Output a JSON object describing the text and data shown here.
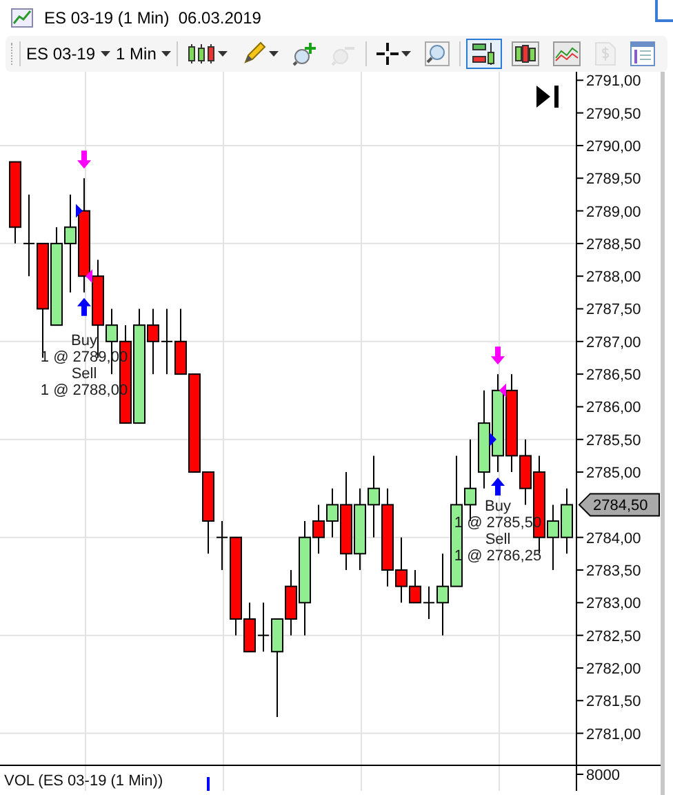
{
  "window": {
    "title": "ES 03-19 (1 Min)  06.03.2019"
  },
  "toolbar": {
    "instrument": "ES 03-19",
    "interval": "1 Min",
    "tools": [
      {
        "kind": "candles",
        "dropdown": true,
        "selected": false,
        "disabled": false
      },
      {
        "kind": "pencil",
        "dropdown": true,
        "selected": false,
        "disabled": false
      },
      {
        "kind": "zoom-in",
        "dropdown": false,
        "selected": false,
        "disabled": false
      },
      {
        "kind": "zoom-out",
        "dropdown": false,
        "selected": false,
        "disabled": true
      },
      {
        "kind": "crosshair",
        "dropdown": true,
        "selected": false,
        "disabled": false
      },
      {
        "kind": "magnifier",
        "dropdown": false,
        "selected": false,
        "disabled": false
      },
      {
        "kind": "trades",
        "dropdown": false,
        "selected": true,
        "disabled": false
      },
      {
        "kind": "bars",
        "dropdown": false,
        "selected": false,
        "disabled": false
      },
      {
        "kind": "indicator",
        "dropdown": false,
        "selected": false,
        "disabled": false
      },
      {
        "kind": "dollar",
        "dropdown": false,
        "selected": false,
        "disabled": true
      },
      {
        "kind": "properties",
        "dropdown": false,
        "selected": false,
        "disabled": false
      }
    ]
  },
  "price_panel": {
    "last_price": "2784,50",
    "chart_data": {
      "type": "candlestick",
      "grid": true,
      "ylim": [
        2780.52,
        2791.13
      ],
      "yticks": [
        {
          "value": 2791,
          "label": "2791,00"
        },
        {
          "value": 2790.5,
          "label": "2790,50"
        },
        {
          "value": 2790,
          "label": "2790,00"
        },
        {
          "value": 2789.5,
          "label": "2789,50"
        },
        {
          "value": 2789,
          "label": "2789,00"
        },
        {
          "value": 2788.5,
          "label": "2788,50"
        },
        {
          "value": 2788,
          "label": "2788,00"
        },
        {
          "value": 2787.5,
          "label": "2787,50"
        },
        {
          "value": 2787,
          "label": "2787,00"
        },
        {
          "value": 2786.5,
          "label": "2786,50"
        },
        {
          "value": 2786,
          "label": "2786,00"
        },
        {
          "value": 2785.5,
          "label": "2785,50"
        },
        {
          "value": 2785,
          "label": "2785,00"
        },
        {
          "value": 2784,
          "label": "2784,00"
        },
        {
          "value": 2783.5,
          "label": "2783,50"
        },
        {
          "value": 2783,
          "label": "2783,00"
        },
        {
          "value": 2782.5,
          "label": "2782,50"
        },
        {
          "value": 2782,
          "label": "2782,00"
        },
        {
          "value": 2781.5,
          "label": "2781,50"
        },
        {
          "value": 2781,
          "label": "2781,00"
        }
      ],
      "ohlc": [
        [
          2789.75,
          2789.75,
          2788.5,
          2788.75
        ],
        [
          2788.5,
          2789.25,
          2788.0,
          2788.5
        ],
        [
          2788.5,
          2788.5,
          2786.75,
          2787.5
        ],
        [
          2787.25,
          2788.75,
          2787.25,
          2788.5
        ],
        [
          2788.5,
          2789.25,
          2787.75,
          2788.75
        ],
        [
          2789.0,
          2789.5,
          2787.75,
          2788.0
        ],
        [
          2788.0,
          2788.25,
          2786.75,
          2787.25
        ],
        [
          2787.0,
          2787.5,
          2786.5,
          2787.25
        ],
        [
          2787.0,
          2787.25,
          2785.75,
          2785.75
        ],
        [
          2785.75,
          2787.5,
          2785.75,
          2787.25
        ],
        [
          2787.25,
          2787.5,
          2786.5,
          2787.0
        ],
        [
          2787.0,
          2787.5,
          2786.5,
          2787.0
        ],
        [
          2787.0,
          2787.5,
          2786.5,
          2786.5
        ],
        [
          2786.5,
          2786.5,
          2785.0,
          2785.0
        ],
        [
          2785.0,
          2785.0,
          2783.75,
          2784.25
        ],
        [
          2784.0,
          2784.25,
          2783.5,
          2784.0
        ],
        [
          2784.0,
          2784.0,
          2782.5,
          2782.75
        ],
        [
          2782.75,
          2783.0,
          2782.25,
          2782.25
        ],
        [
          2782.5,
          2783.0,
          2782.25,
          2782.5
        ],
        [
          2782.25,
          2782.75,
          2781.25,
          2782.75
        ],
        [
          2783.25,
          2783.5,
          2782.5,
          2782.75
        ],
        [
          2783.0,
          2784.25,
          2782.5,
          2784.0
        ],
        [
          2784.25,
          2784.5,
          2783.75,
          2784.0
        ],
        [
          2784.25,
          2784.75,
          2784.0,
          2784.5
        ],
        [
          2784.5,
          2785.0,
          2783.5,
          2783.75
        ],
        [
          2783.75,
          2784.75,
          2783.5,
          2784.5
        ],
        [
          2784.5,
          2785.25,
          2784.0,
          2784.75
        ],
        [
          2784.5,
          2784.75,
          2783.25,
          2783.5
        ],
        [
          2783.5,
          2784.0,
          2783.0,
          2783.25
        ],
        [
          2783.25,
          2783.5,
          2783.0,
          2783.0
        ],
        [
          2783.0,
          2783.25,
          2782.75,
          2783.0
        ],
        [
          2783.0,
          2783.75,
          2782.5,
          2783.25
        ],
        [
          2783.25,
          2785.25,
          2783.25,
          2784.5
        ],
        [
          2784.5,
          2785.5,
          2784.25,
          2784.75
        ],
        [
          2785.0,
          2786.25,
          2784.75,
          2785.75
        ],
        [
          2785.25,
          2786.5,
          2785.0,
          2786.25
        ],
        [
          2786.25,
          2786.5,
          2785.0,
          2785.25
        ],
        [
          2785.25,
          2785.5,
          2784.5,
          2784.75
        ],
        [
          2785.0,
          2785.25,
          2783.75,
          2784.0
        ],
        [
          2784.0,
          2784.5,
          2783.5,
          2784.25
        ],
        [
          2784.0,
          2784.75,
          2783.75,
          2784.5
        ]
      ],
      "annotations": [
        "Buy",
        "1 @ 2789,00",
        "Sell",
        "1 @ 2788,00",
        "Buy",
        "1 @ 2785,50",
        "Sell",
        "1 @ 2786,25"
      ]
    }
  },
  "volume_panel": {
    "title": "VOL (ES 03-19 (1 Min))",
    "axis_label": "8000"
  }
}
